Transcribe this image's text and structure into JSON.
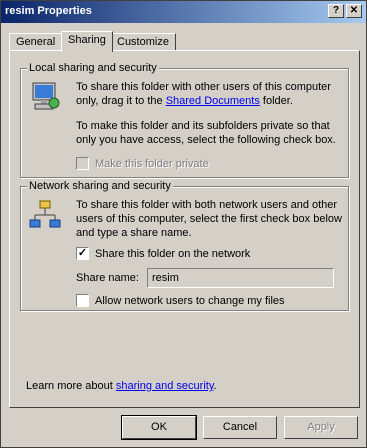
{
  "window": {
    "title": "resim Properties",
    "help_button": "?",
    "close_button": "✕"
  },
  "tabs": [
    {
      "label": "General"
    },
    {
      "label": "Sharing"
    },
    {
      "label": "Customize"
    }
  ],
  "local": {
    "legend": "Local sharing and security",
    "para1_pre": "To share this folder with other users of this computer only, drag it to the ",
    "shared_link": "Shared Documents",
    "para1_post": " folder.",
    "para2": "To make this folder and its subfolders private so that only you have access, select the following check box.",
    "private_label": "Make this folder private",
    "private_checked": false
  },
  "network": {
    "legend": "Network sharing and security",
    "para": "To share this folder with both network users and other users of this computer, select the first check box below and type a share name.",
    "share_label": "Share this folder on the network",
    "share_checked": true,
    "share_name_label": "Share name:",
    "share_name_value": "resim",
    "allow_label": "Allow network users to change my files",
    "allow_checked": false
  },
  "learn": {
    "prefix": "Learn more about ",
    "link": "sharing and security",
    "suffix": "."
  },
  "buttons": {
    "ok": "OK",
    "cancel": "Cancel",
    "apply": "Apply"
  },
  "colors": {
    "titlebar_start": "#0a246a",
    "titlebar_end": "#a6caf0",
    "face": "#d4d0c8",
    "link": "#0000ee"
  }
}
